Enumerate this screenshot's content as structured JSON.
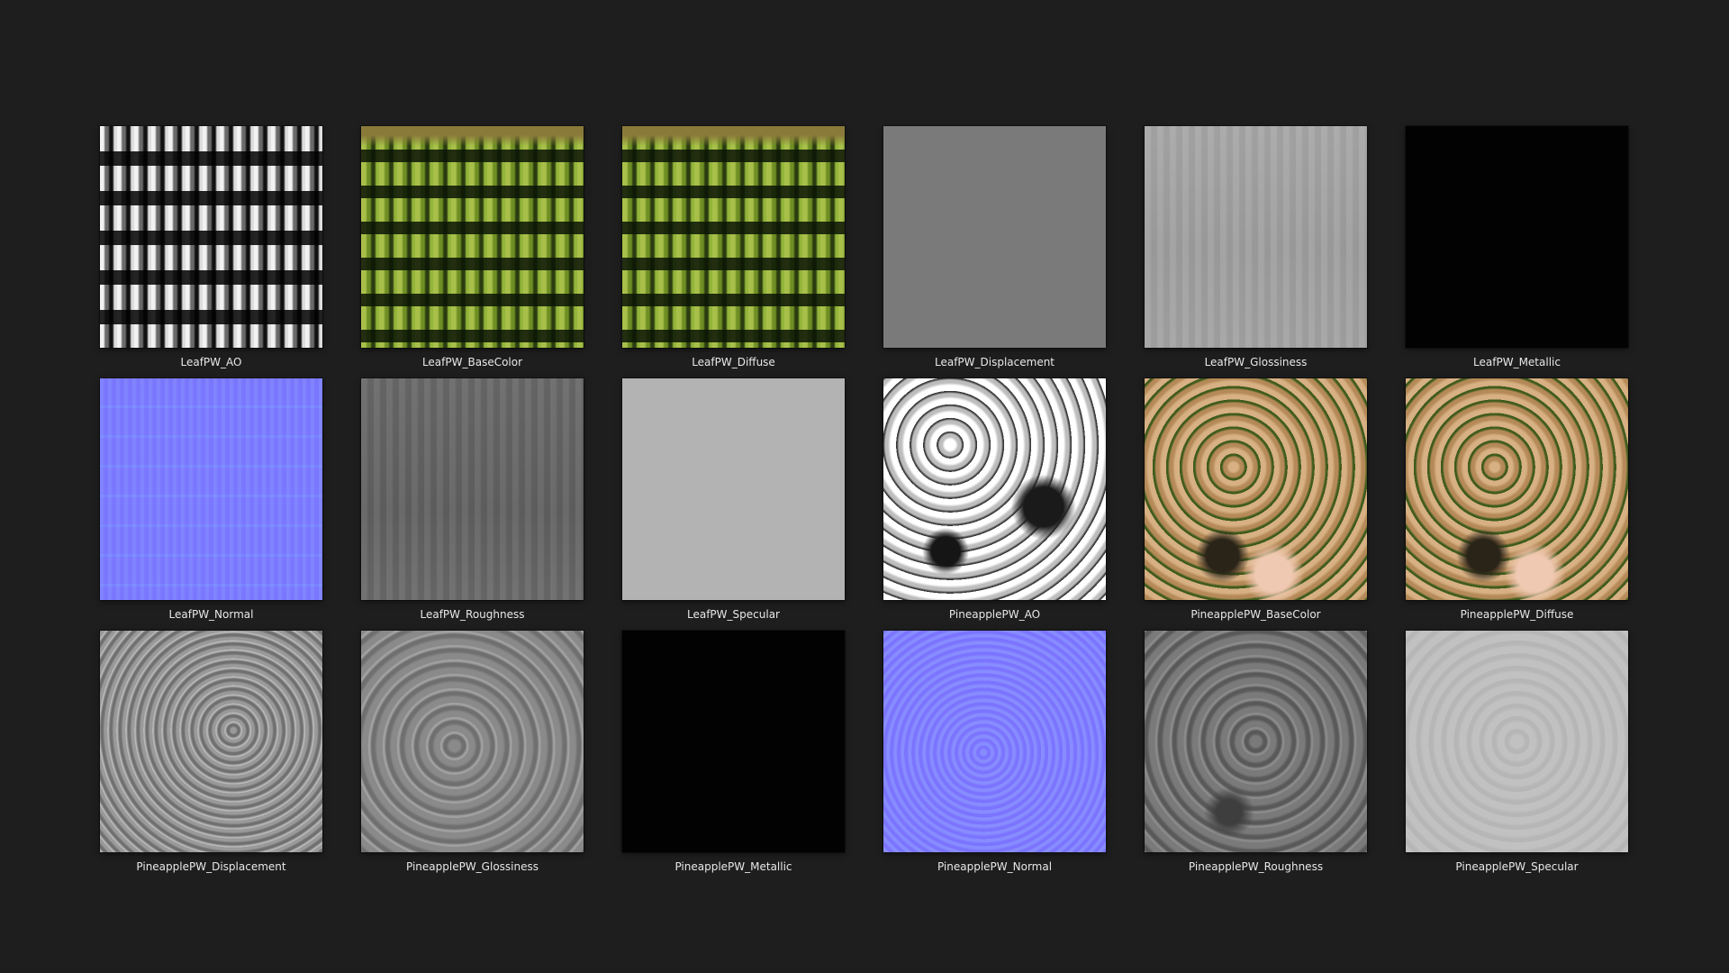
{
  "gallery": {
    "items": [
      {
        "label": "LeafPW_AO"
      },
      {
        "label": "LeafPW_BaseColor"
      },
      {
        "label": "LeafPW_Diffuse"
      },
      {
        "label": "LeafPW_Displacement"
      },
      {
        "label": "LeafPW_Glossiness"
      },
      {
        "label": "LeafPW_Metallic"
      },
      {
        "label": "LeafPW_Normal"
      },
      {
        "label": "LeafPW_Roughness"
      },
      {
        "label": "LeafPW_Specular"
      },
      {
        "label": "PineapplePW_AO"
      },
      {
        "label": "PineapplePW_BaseColor"
      },
      {
        "label": "PineapplePW_Diffuse"
      },
      {
        "label": "PineapplePW_Displacement"
      },
      {
        "label": "PineapplePW_Glossiness"
      },
      {
        "label": "PineapplePW_Metallic"
      },
      {
        "label": "PineapplePW_Normal"
      },
      {
        "label": "PineapplePW_Roughness"
      },
      {
        "label": "PineapplePW_Specular"
      }
    ]
  },
  "colors": {
    "background": "#1e1e1e",
    "label_text": "#e8e8e8",
    "normal_map_blue": "#7f7cff"
  }
}
